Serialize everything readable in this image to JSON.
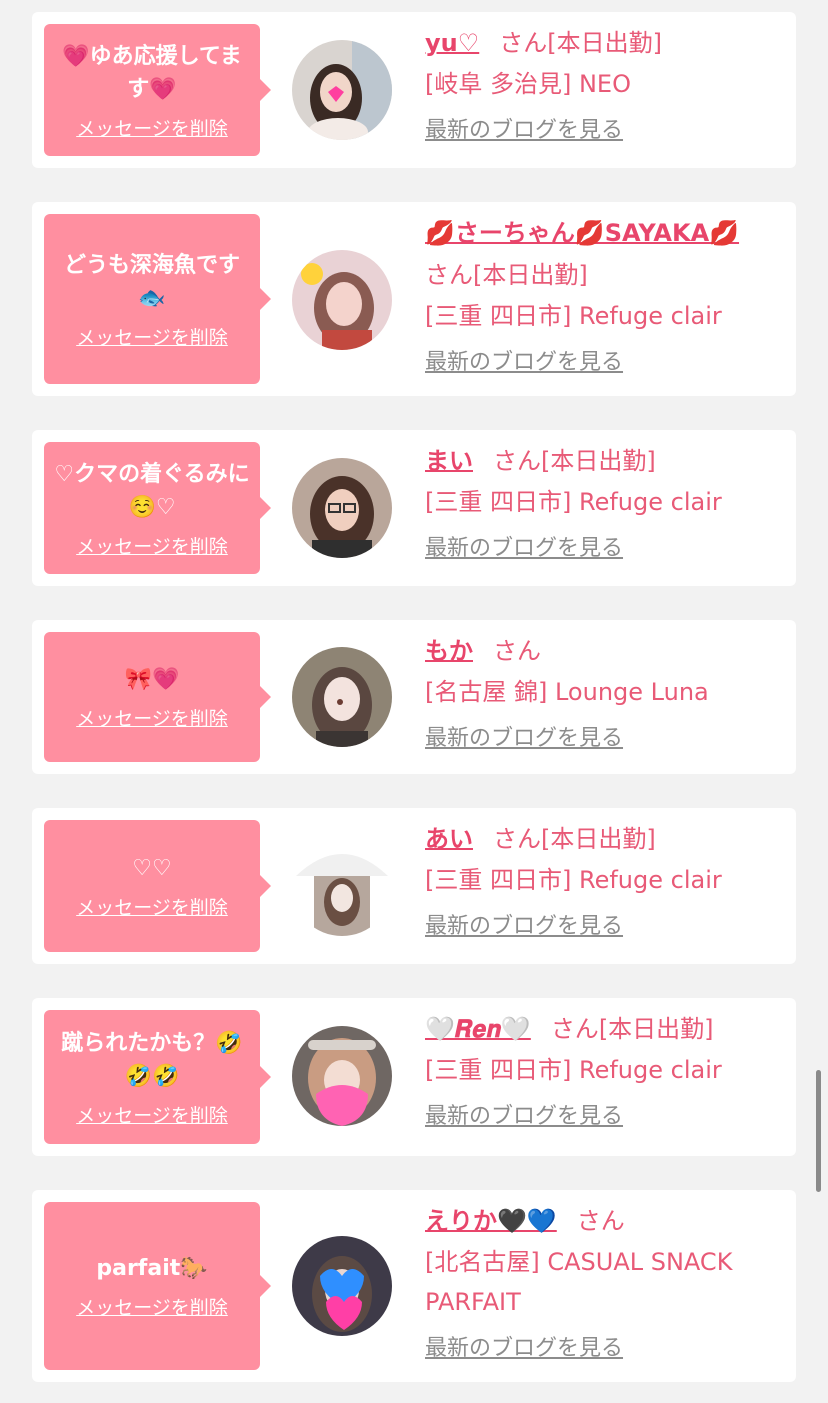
{
  "colors": {
    "background": "#f2f2f2",
    "card": "#ffffff",
    "bubble": "#ff8fa0",
    "name": "#e8456b",
    "text": "#e85a77",
    "blog_link": "#8c8c8c"
  },
  "entries": [
    {
      "message": "💗ゆあ応援してます💗",
      "delete_label": "メッセージを削除",
      "name": "yu♡",
      "honorific": "さん",
      "status": "[本日出勤]",
      "shop": "[岐阜 多治見] NEO",
      "blog_label": "最新のブログを見る",
      "avatar": "photo-avatar-icon"
    },
    {
      "message": "どうも深海魚です🐟",
      "delete_label": "メッセージを削除",
      "name": "💋さーちゃん💋SAYAKA💋",
      "honorific": "さん",
      "status": "[本日出勤]",
      "shop": "[三重 四日市] Refuge clair",
      "blog_label": "最新のブログを見る",
      "avatar": "photo-avatar-icon"
    },
    {
      "message": "♡クマの着ぐるみに☺️♡",
      "delete_label": "メッセージを削除",
      "name": "まい",
      "honorific": "さん",
      "status": "[本日出勤]",
      "shop": "[三重 四日市] Refuge clair",
      "blog_label": "最新のブログを見る",
      "avatar": "photo-avatar-icon"
    },
    {
      "message": "🎀💗",
      "delete_label": "メッセージを削除",
      "name": "もか",
      "honorific": "さん",
      "status": "",
      "shop": "[名古屋 錦] Lounge Luna",
      "blog_label": "最新のブログを見る",
      "avatar": "photo-avatar-icon"
    },
    {
      "message": "♡♡",
      "delete_label": "メッセージを削除",
      "name": "あい",
      "honorific": "さん",
      "status": "[本日出勤]",
      "shop": "[三重 四日市] Refuge clair",
      "blog_label": "最新のブログを見る",
      "avatar": "photo-avatar-icon"
    },
    {
      "message": "蹴られたかも？🤣🤣🤣",
      "delete_label": "メッセージを削除",
      "name": "🤍𝑹𝒆𝒏🤍",
      "honorific": "さん",
      "status": "[本日出勤]",
      "shop": "[三重 四日市] Refuge clair",
      "blog_label": "最新のブログを見る",
      "avatar": "photo-avatar-icon"
    },
    {
      "message": "parfait🐎",
      "delete_label": "メッセージを削除",
      "name": "えりか🖤💙",
      "honorific": "さん",
      "status": "",
      "shop": "[北名古屋] CASUAL SNACK PARFAIT",
      "blog_label": "最新のブログを見る",
      "avatar": "photo-avatar-icon"
    }
  ]
}
